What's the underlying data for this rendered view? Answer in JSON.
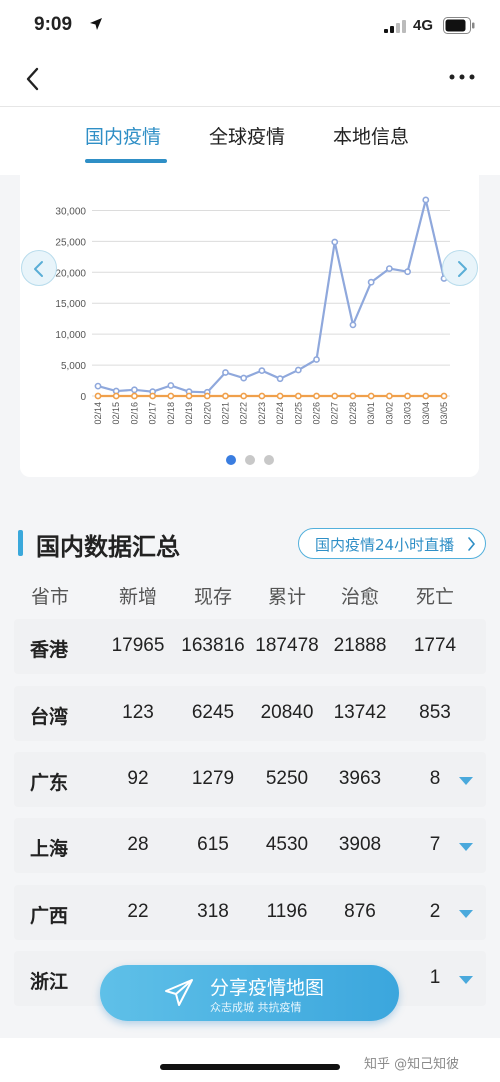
{
  "status": {
    "time": "9:09",
    "network": "4G"
  },
  "tabs": [
    {
      "label": "国内疫情",
      "active": true
    },
    {
      "label": "全球疫情",
      "active": false
    },
    {
      "label": "本地信息",
      "active": false
    }
  ],
  "chart_data": {
    "type": "line",
    "x": [
      "02/14",
      "02/15",
      "02/16",
      "02/17",
      "02/18",
      "02/19",
      "02/20",
      "02/21",
      "02/22",
      "02/23",
      "02/24",
      "02/25",
      "02/26",
      "02/27",
      "02/28",
      "03/01",
      "03/02",
      "03/03",
      "03/04",
      "03/05"
    ],
    "series": [
      {
        "values": [
          1600,
          800,
          1000,
          700,
          1700,
          700,
          600,
          3800,
          2900,
          4100,
          2800,
          4200,
          5900,
          24900,
          11500,
          18400,
          20600,
          20100,
          31700,
          19000
        ],
        "color": "#8fa8dc"
      },
      {
        "values": [
          0,
          0,
          0,
          0,
          0,
          0,
          0,
          0,
          0,
          0,
          0,
          0,
          0,
          0,
          0,
          0,
          0,
          0,
          0,
          0
        ],
        "color": "#f0a04b"
      }
    ],
    "y_ticks": [
      "0",
      "5,000",
      "10,000",
      "15,000",
      "20,000",
      "25,000",
      "30,000"
    ],
    "ylim": [
      0,
      32500
    ],
    "grid": true,
    "pager": {
      "pages": 3,
      "active": 0
    }
  },
  "section": {
    "title": "国内数据汇总",
    "live_link": "国内疫情24小时直播"
  },
  "table": {
    "headers": [
      "省市",
      "新增",
      "现存",
      "累计",
      "治愈",
      "死亡"
    ],
    "rows": [
      {
        "name": "香港",
        "new": "17965",
        "current": "163816",
        "total": "187478",
        "cured": "21888",
        "deaths": "1774",
        "expandable": false
      },
      {
        "name": "台湾",
        "new": "123",
        "current": "6245",
        "total": "20840",
        "cured": "13742",
        "deaths": "853",
        "expandable": false
      },
      {
        "name": "广东",
        "new": "92",
        "current": "1279",
        "total": "5250",
        "cured": "3963",
        "deaths": "8",
        "expandable": true
      },
      {
        "name": "上海",
        "new": "28",
        "current": "615",
        "total": "4530",
        "cured": "3908",
        "deaths": "7",
        "expandable": true
      },
      {
        "name": "广西",
        "new": "22",
        "current": "318",
        "total": "1196",
        "cured": "876",
        "deaths": "2",
        "expandable": true
      },
      {
        "name": "浙江",
        "new": "",
        "current": "",
        "total": "",
        "cured": "",
        "deaths": "1",
        "expandable": true
      }
    ]
  },
  "fab": {
    "title": "分享疫情地图",
    "subtitle": "众志成城 共抗疫情"
  },
  "watermark": "知乎 @知己知彼",
  "colors": {
    "accent": "#2f8fc6",
    "row_bg": "#f0f1f3",
    "fab": "#46b2e2"
  }
}
